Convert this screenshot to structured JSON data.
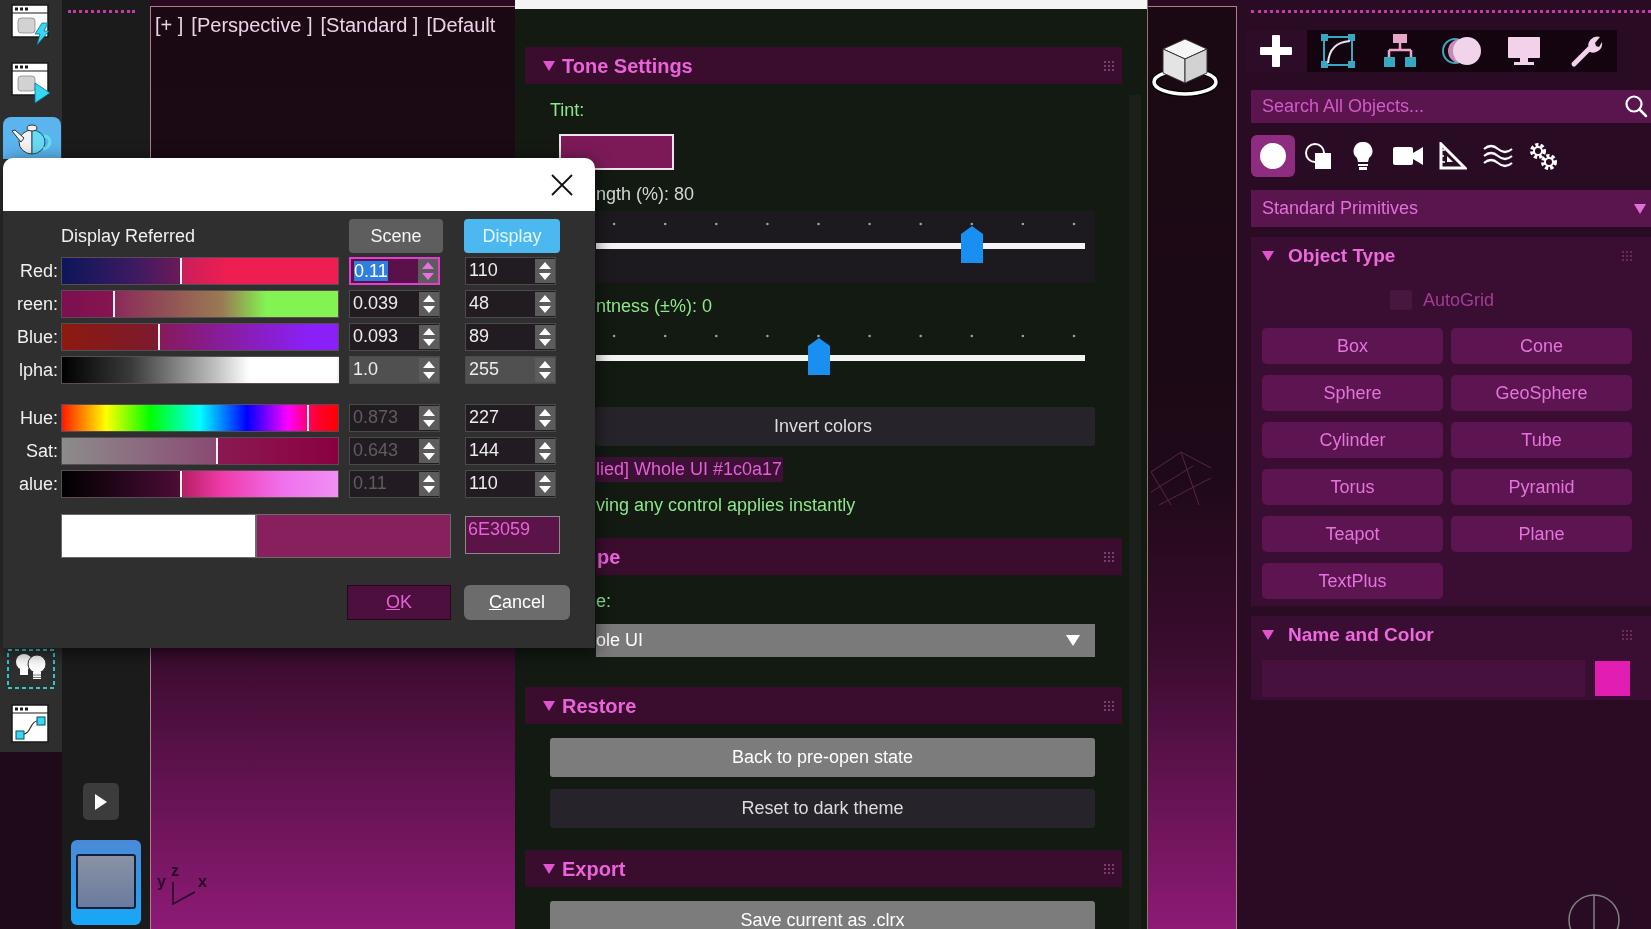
{
  "left_toolbar": [
    {
      "kind": "lightning",
      "selected": false
    },
    {
      "kind": "play",
      "selected": false
    },
    {
      "kind": "teapot",
      "selected": true
    },
    {
      "kind": "lights",
      "selected": false
    },
    {
      "kind": "graph",
      "selected": false
    }
  ],
  "viewport": {
    "labels": [
      "[+ ]",
      "[Perspective ]",
      "[Standard ]",
      "[Default"
    ],
    "axis_labels": [
      "y",
      "z",
      "x"
    ]
  },
  "theme_panel": {
    "sections": [
      {
        "title": "Tone Settings",
        "expanded": true,
        "covered": false,
        "items": [
          {
            "kind": "label",
            "text": "Tint:",
            "covered": false
          },
          {
            "kind": "swatch",
            "color": "#7c1a58",
            "covered": false
          },
          {
            "kind": "reading",
            "text": "ngth (%): 80",
            "covered": true
          },
          {
            "kind": "slider",
            "level": 0.8,
            "focused": true,
            "covered": true
          },
          {
            "kind": "label",
            "text": "ntness (±%): 0",
            "covered": true
          },
          {
            "kind": "slider",
            "level": 0.5,
            "focused": false,
            "covered": true
          },
          {
            "kind": "button",
            "label": "Invert colors",
            "highlighted": false,
            "covered": true
          },
          {
            "kind": "status",
            "text": "lied] Whole UI #1c0a17",
            "covered": true
          },
          {
            "kind": "label",
            "text": "ving any control applies instantly",
            "covered": true
          }
        ]
      },
      {
        "title": "pe",
        "expanded": true,
        "covered": true,
        "items": [
          {
            "kind": "label",
            "text": "e:",
            "covered": true
          },
          {
            "kind": "dropdown",
            "value": "ole UI",
            "covered": true
          }
        ]
      },
      {
        "title": "Restore",
        "expanded": true,
        "covered": false,
        "items": [
          {
            "kind": "button",
            "label": "Back to pre-open state",
            "highlighted": true,
            "covered": false
          },
          {
            "kind": "button",
            "label": "Reset to dark theme",
            "highlighted": false,
            "covered": false
          }
        ]
      },
      {
        "title": "Export",
        "expanded": true,
        "covered": false,
        "items": [
          {
            "kind": "button",
            "label": "Save current as .clrx",
            "highlighted": true,
            "covered": false
          }
        ]
      }
    ]
  },
  "color_dialog": {
    "heading": "Display Referred",
    "mode_buttons": [
      {
        "label": "Scene",
        "selected": false
      },
      {
        "label": "Display",
        "selected": true
      }
    ],
    "groups": [
      {
        "channels": [
          {
            "kind": "red",
            "label": "Red:",
            "level": 0.43,
            "scene": {
              "value": "0.11",
              "focused": true,
              "disabled": false
            },
            "display": {
              "value": "110"
            }
          },
          {
            "kind": "green",
            "label": "reen:",
            "level": 0.19,
            "scene": {
              "value": "0.039",
              "focused": false,
              "disabled": false
            },
            "display": {
              "value": "48"
            }
          },
          {
            "kind": "blue",
            "label": "Blue:",
            "level": 0.35,
            "scene": {
              "value": "0.093",
              "focused": false,
              "disabled": false
            },
            "display": {
              "value": "89"
            }
          },
          {
            "kind": "alpha",
            "label": "lpha:",
            "level": 1.0,
            "scene": {
              "value": "1.0",
              "focused": false,
              "disabled": false
            },
            "display": {
              "value": "255"
            }
          }
        ]
      },
      {
        "channels": [
          {
            "kind": "hue",
            "label": "Hue:",
            "level": 0.89,
            "scene": {
              "value": "0.873",
              "focused": false,
              "disabled": true
            },
            "display": {
              "value": "227"
            }
          },
          {
            "kind": "sat",
            "label": "Sat:",
            "level": 0.56,
            "scene": {
              "value": "0.643",
              "focused": false,
              "disabled": true
            },
            "display": {
              "value": "144"
            }
          },
          {
            "kind": "value",
            "label": "alue:",
            "level": 0.43,
            "scene": {
              "value": "0.11",
              "focused": false,
              "disabled": true
            },
            "display": {
              "value": "110"
            }
          }
        ]
      }
    ],
    "swatches": [
      {
        "color": "#ffffff"
      },
      {
        "color": "#87205c"
      }
    ],
    "hex": "6E3059",
    "buttons": [
      {
        "label": "OK",
        "default": true
      },
      {
        "label": "Cancel",
        "default": false
      }
    ]
  },
  "command_panel": {
    "tabs": [
      {
        "kind": "plus",
        "selected": true
      },
      {
        "kind": "curve",
        "selected": false
      },
      {
        "kind": "tree",
        "selected": false
      },
      {
        "kind": "circles",
        "selected": false
      },
      {
        "kind": "monitor",
        "selected": false
      },
      {
        "kind": "wrench",
        "selected": false
      }
    ],
    "search": {
      "placeholder": "Search All Objects..."
    },
    "categories": [
      {
        "kind": "sphere",
        "selected": true
      },
      {
        "kind": "shapes",
        "selected": false
      },
      {
        "kind": "bulb",
        "selected": false
      },
      {
        "kind": "camera",
        "selected": false
      },
      {
        "kind": "ruler",
        "selected": false
      },
      {
        "kind": "waves",
        "selected": false
      },
      {
        "kind": "gears",
        "selected": false
      }
    ],
    "category_dropdown": {
      "value": "Standard Primitives"
    },
    "object_type": {
      "title": "Object Type",
      "expanded": true,
      "autogrid": {
        "label": "AutoGrid",
        "checked": false,
        "disabled": true
      },
      "buttons": [
        "Box",
        "Cone",
        "Sphere",
        "GeoSphere",
        "Cylinder",
        "Tube",
        "Torus",
        "Pyramid",
        "Teapot",
        "Plane",
        "TextPlus"
      ]
    },
    "name_and_color": {
      "title": "Name and Color",
      "expanded": true,
      "color": "#e21db2"
    }
  }
}
